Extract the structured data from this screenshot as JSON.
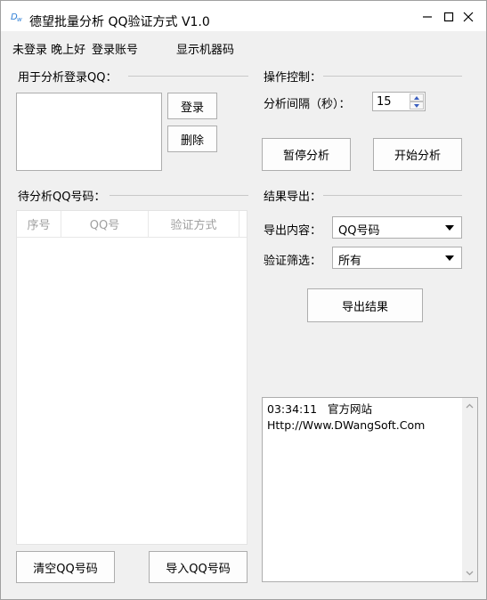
{
  "window": {
    "title": "德望批量分析 QQ验证方式 V1.0",
    "icon": "app-logo-icon",
    "controls": [
      "minimize-icon",
      "maximize-icon",
      "close-icon"
    ]
  },
  "menu": {
    "status": "未登录 晚上好",
    "login_account": "登录账号",
    "show_machine_code": "显示机器码"
  },
  "left": {
    "login_qq_label": "用于分析登录QQ：",
    "login_button": "登录",
    "delete_button": "删除",
    "pending_label": "待分析QQ号码：",
    "table": {
      "columns": [
        "序号",
        "QQ号",
        "验证方式"
      ],
      "rows": []
    },
    "clear_button": "清空QQ号码",
    "import_button": "导入QQ号码"
  },
  "right": {
    "control_label": "操作控制：",
    "interval_label": "分析间隔（秒）：",
    "interval_value": "15",
    "pause_button": "暂停分析",
    "start_button": "开始分析",
    "export_label": "结果导出：",
    "export_content_label": "导出内容：",
    "export_content_value": "QQ号码",
    "verify_filter_label": "验证筛选：",
    "verify_filter_value": "所有",
    "export_button": "导出结果",
    "log": {
      "line1": "03:34:11   官方网站",
      "line2": "Http://Www.DWangSoft.Com"
    }
  },
  "colors": {
    "window_bg": "#f0f0f0",
    "titlebar_bg": "#ffffff",
    "border": "#adadad",
    "disabled_text": "#a0a0a0"
  }
}
